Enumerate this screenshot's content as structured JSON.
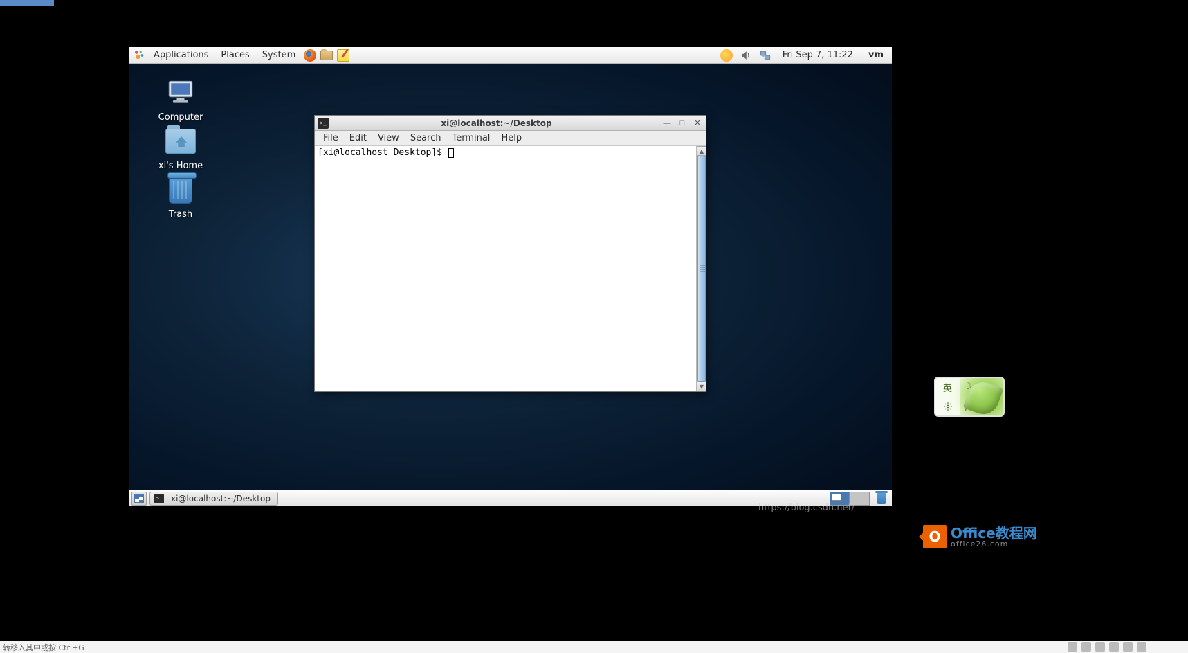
{
  "top_panel": {
    "menus": {
      "applications": "Applications",
      "places": "Places",
      "system": "System"
    },
    "clock": "Fri Sep  7, 11:22",
    "user": "vm"
  },
  "desktop_icons": {
    "computer": "Computer",
    "home": "xi's Home",
    "trash": "Trash"
  },
  "terminal": {
    "title": "xi@localhost:~/Desktop",
    "menus": {
      "file": "File",
      "edit": "Edit",
      "view": "View",
      "search": "Search",
      "terminal": "Terminal",
      "help": "Help"
    },
    "prompt": "[xi@localhost Desktop]$ "
  },
  "bottom_panel": {
    "task_label": "xi@localhost:~/Desktop"
  },
  "ime": {
    "lang": "英",
    "punct": "；"
  },
  "watermark": {
    "brand_en": "Office",
    "brand_cn": "教程网",
    "domain": "office26.com",
    "url_fragment": "https://blog.csdn.net/"
  },
  "host": {
    "hint_fragment": "转移入其中或按 Ctrl+G"
  }
}
